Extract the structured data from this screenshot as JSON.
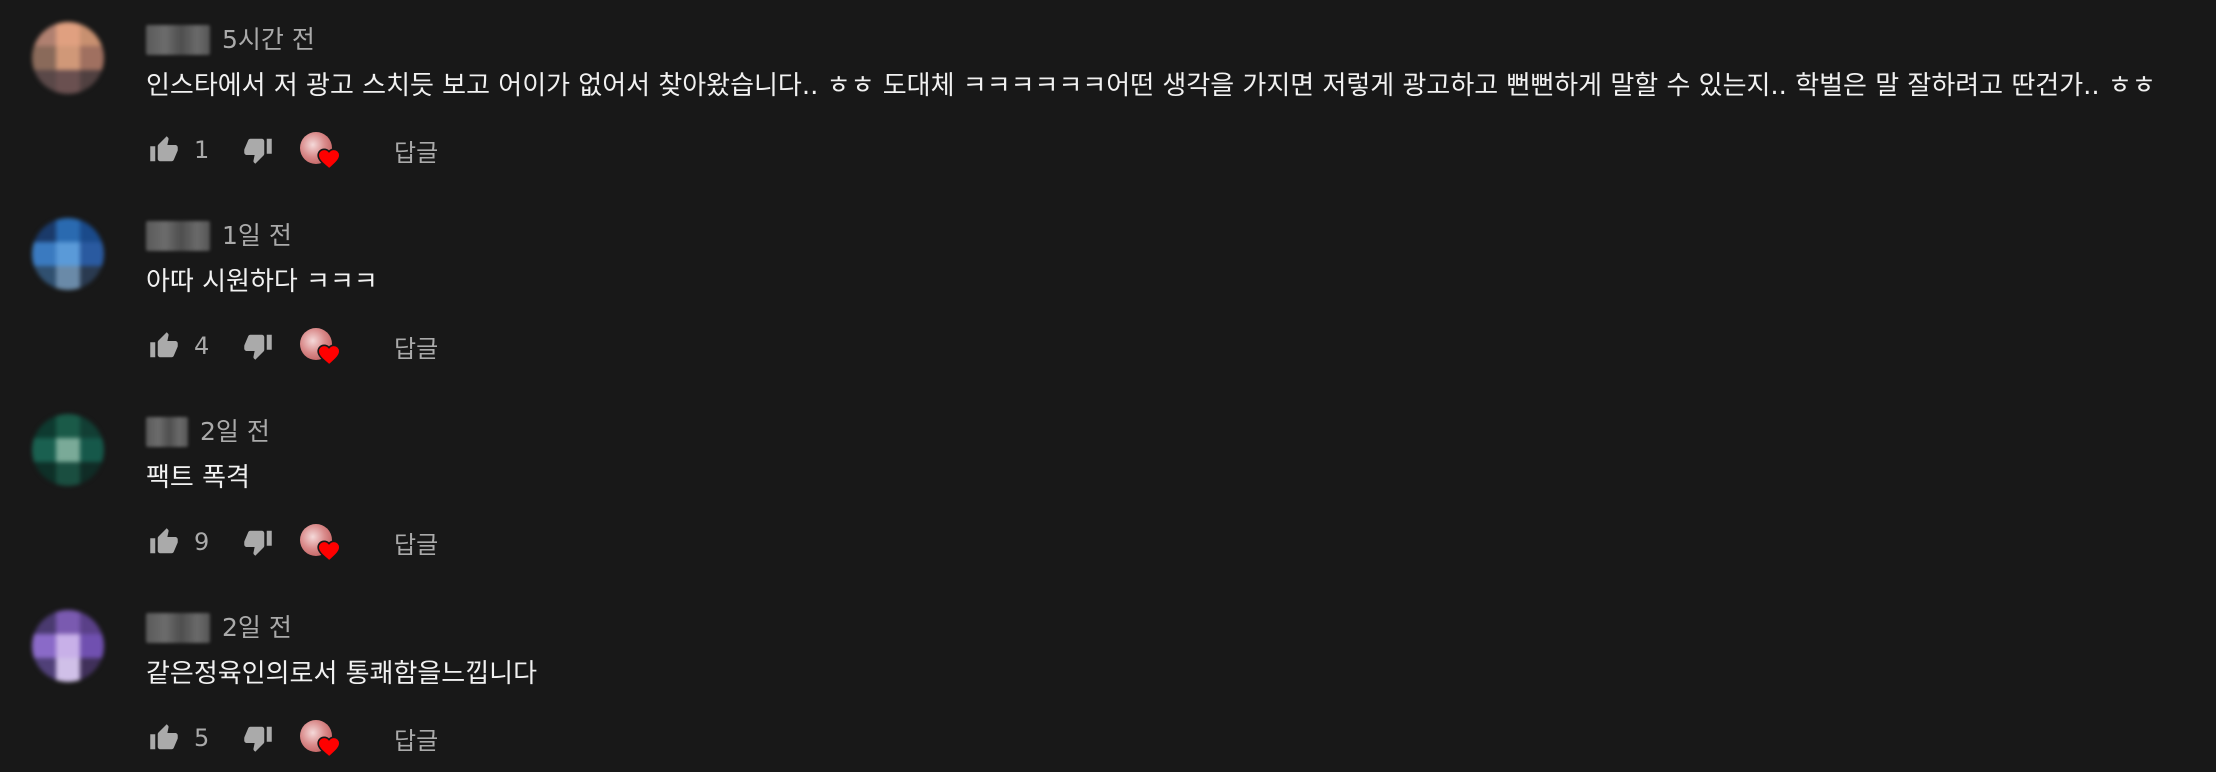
{
  "comments": [
    {
      "timestamp": "5시간 전",
      "text": "인스타에서 저 광고 스치듯 보고 어이가 없어서 찾아왔습니다.. ㅎㅎ 도대체 ㅋㅋㅋㅋㅋㅋ어떤 생각을 가지면 저렇게 광고하고 뻔뻔하게 말할 수 있는지.. 학벌은 말 잘하려고 딴건가.. ㅎㅎ",
      "likes": "1",
      "reply_label": "답글",
      "avatar_colors": [
        "#b08070",
        "#e0a080",
        "#c89070",
        "#8a6a5a",
        "#d09878",
        "#a07060",
        "#5a4848",
        "#6a5050",
        "#504040"
      ]
    },
    {
      "timestamp": "1일 전",
      "text": "아따 시원하다 ㅋㅋㅋ",
      "likes": "4",
      "reply_label": "답글",
      "avatar_colors": [
        "#1a3a6a",
        "#2a6ab0",
        "#1a4a8a",
        "#3a7ac0",
        "#5a9ad8",
        "#2a5aa0",
        "#305070",
        "#6a8aa8",
        "#2a3a50"
      ]
    },
    {
      "timestamp": "2일 전",
      "text": "팩트 폭격",
      "likes": "9",
      "reply_label": "답글",
      "avatar_colors": [
        "#0e3a30",
        "#1a5a48",
        "#123e34",
        "#1a6050",
        "#7aaa98",
        "#16584a",
        "#0e3028",
        "#1a4e40",
        "#102c26"
      ]
    },
    {
      "timestamp": "2일 전",
      "text": "같은정육인의로서 통쾌함을느낍니다",
      "likes": "5",
      "reply_label": "답글",
      "avatar_colors": [
        "#4a3a70",
        "#7a5ab0",
        "#5a4088",
        "#8a6ac8",
        "#c8b0e8",
        "#7050b0",
        "#504078",
        "#d0c0e8",
        "#40305a"
      ]
    }
  ],
  "colors": {
    "background": "#181818",
    "text": "#f1f1f1",
    "secondary": "#aaaaaa",
    "heart": "#ff0000"
  },
  "icons": [
    "thumbs-up-icon",
    "thumbs-down-icon",
    "creator-heart-icon"
  ]
}
